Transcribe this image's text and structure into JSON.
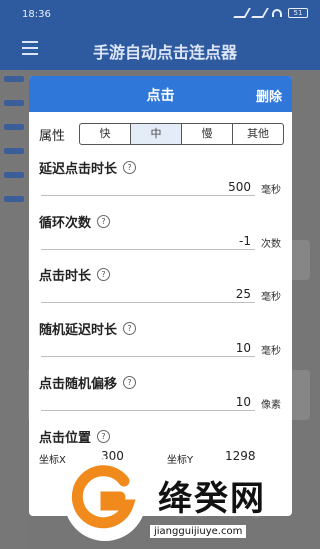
{
  "status": {
    "time": "18:36",
    "battery": "51"
  },
  "app": {
    "title": "手游自动点击连点器"
  },
  "dialog": {
    "title": "点击",
    "delete_label": "删除",
    "attribute": {
      "label": "属性",
      "options": [
        "快",
        "中",
        "慢",
        "其他"
      ],
      "selected": "中"
    },
    "fields": [
      {
        "label": "延迟点击时长",
        "value": "500",
        "unit": "毫秒"
      },
      {
        "label": "循环次数",
        "value": "-1",
        "unit": "次数"
      },
      {
        "label": "点击时长",
        "value": "25",
        "unit": "毫秒"
      },
      {
        "label": "随机延迟时长",
        "value": "10",
        "unit": "毫秒"
      },
      {
        "label": "点击随机偏移",
        "value": "10",
        "unit": "像素"
      }
    ],
    "position": {
      "label": "点击位置",
      "x_label": "坐标X",
      "x_value": "300",
      "y_label": "坐标Y",
      "y_value": "1298"
    },
    "help_glyph": "?"
  },
  "watermark": {
    "text": "绛癸网",
    "url": "jiangguijiuye.com"
  }
}
